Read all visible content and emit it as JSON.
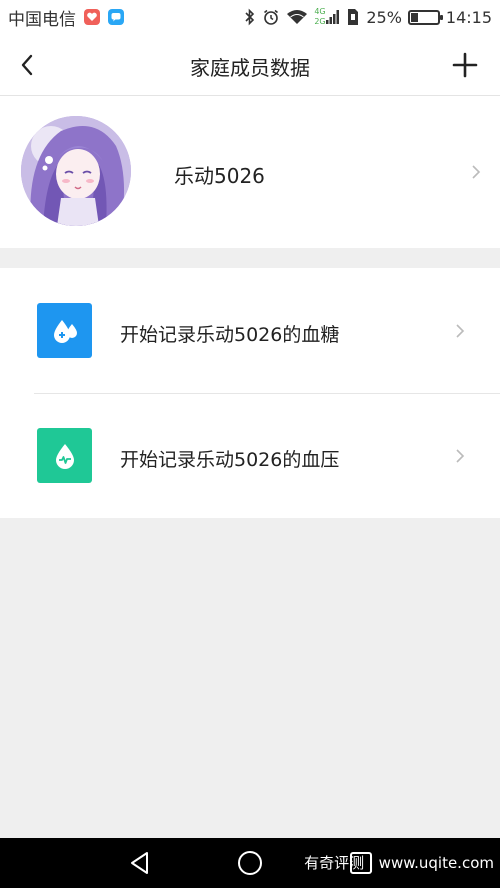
{
  "status_bar": {
    "carrier": "中国电信",
    "battery_percent": "25%",
    "battery_level": 0.25,
    "time": "14:15",
    "network_small_top": "4G",
    "network_small_bottom": "2G"
  },
  "nav": {
    "title": "家庭成员数据",
    "back_icon": "chevron-left-icon",
    "add_icon": "plus-icon"
  },
  "profile": {
    "name": "乐动5026"
  },
  "records": [
    {
      "label": "开始记录乐动5026的血糖",
      "icon": "blood-sugar-drop-icon",
      "color": "#1e96f0"
    },
    {
      "label": "开始记录乐动5026的血压",
      "icon": "blood-pressure-drop-icon",
      "color": "#1fc896"
    }
  ],
  "system_nav": {
    "watermark": "有奇评测 | www.uqite.com"
  }
}
